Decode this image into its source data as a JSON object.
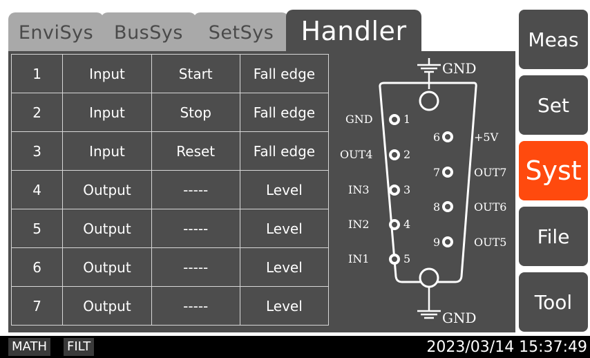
{
  "tabs": [
    "EnviSys",
    "BusSys",
    "SetSys",
    "Handler"
  ],
  "active_tab": "Handler",
  "table": {
    "rows": [
      [
        "1",
        "Input",
        "Start",
        "Fall edge"
      ],
      [
        "2",
        "Input",
        "Stop",
        "Fall edge"
      ],
      [
        "3",
        "Input",
        "Reset",
        "Fall edge"
      ],
      [
        "4",
        "Output",
        "-----",
        "Level"
      ],
      [
        "5",
        "Output",
        "-----",
        "Level"
      ],
      [
        "6",
        "Output",
        "-----",
        "Level"
      ],
      [
        "7",
        "Output",
        "-----",
        "Level"
      ]
    ]
  },
  "connector": {
    "top_label": "GND",
    "bottom_label": "GND",
    "left_pins": [
      {
        "label": "GND",
        "num": "1"
      },
      {
        "label": "OUT4",
        "num": "2"
      },
      {
        "label": "IN3",
        "num": "3"
      },
      {
        "label": "IN2",
        "num": "4"
      },
      {
        "label": "IN1",
        "num": "5"
      }
    ],
    "right_pins": [
      {
        "label": "+5V",
        "num": "6"
      },
      {
        "label": "OUT7",
        "num": "7"
      },
      {
        "label": "OUT6",
        "num": "8"
      },
      {
        "label": "OUT5",
        "num": "9"
      }
    ]
  },
  "side_buttons": [
    "Meas",
    "Set",
    "Syst",
    "File",
    "Tool"
  ],
  "active_side_button": "Syst",
  "status": {
    "chips": [
      "MATH",
      "FILT"
    ],
    "datetime": "2023/03/14 15:37:49"
  },
  "colors": {
    "panel": "#4d4d4d",
    "inactive_tab": "#a9a9a9",
    "accent": "#ff4a0e",
    "status_bar": "#000000"
  }
}
